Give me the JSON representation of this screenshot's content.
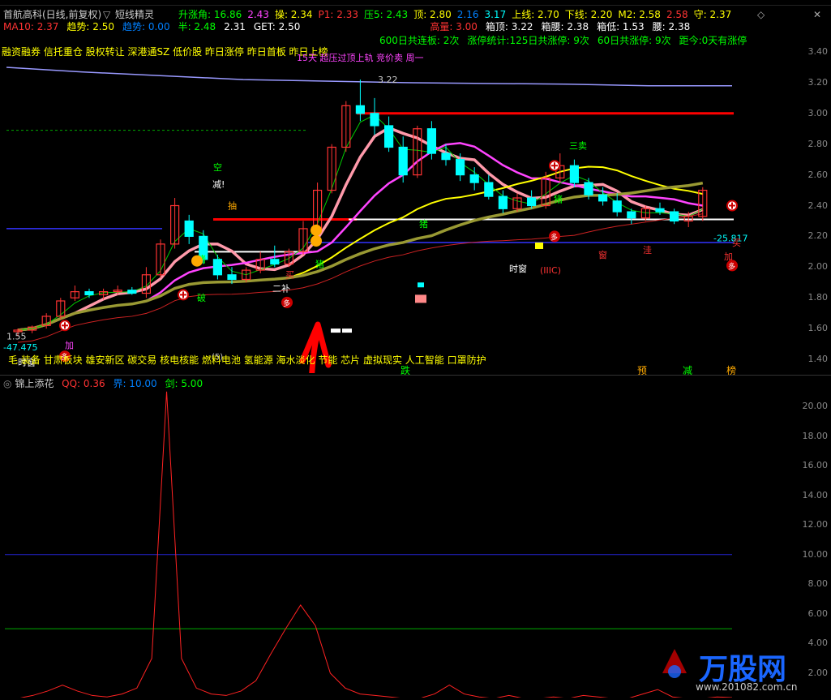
{
  "toolbar": {
    "title": "首航高科(日线,前复权)",
    "chevron": "▽",
    "tool_name": "短线精灵",
    "diamond": "◇",
    "close": "✕"
  },
  "row1": [
    {
      "text": "升涨角: 16.86",
      "color": "#00ff00"
    },
    {
      "text": "2.43",
      "color": "#ff44ff"
    },
    {
      "text": "操: 2.34",
      "color": "#ffff00"
    },
    {
      "text": "P1: 2.33",
      "color": "#ff3333"
    },
    {
      "text": "压5: 2.43",
      "color": "#00ff00"
    },
    {
      "text": "顶: 2.80",
      "color": "#ffff00"
    },
    {
      "text": "2.16",
      "color": "#0080ff"
    },
    {
      "text": "3.17",
      "color": "#00ffff"
    },
    {
      "text": "上线: 2.70",
      "color": "#ffff00"
    },
    {
      "text": "下线: 2.20",
      "color": "#ffff00"
    },
    {
      "text": "M2: 2.58",
      "color": "#ffff00"
    },
    {
      "text": "2.58",
      "color": "#ff3333"
    },
    {
      "text": "守: 2.37",
      "color": "#ffff00"
    }
  ],
  "row2": [
    {
      "text": "MA10: 2.37",
      "color": "#ff3333"
    },
    {
      "text": "趋势: 2.50",
      "color": "#ffff00"
    },
    {
      "text": "趋势: 0.00",
      "color": "#0080ff"
    },
    {
      "text": "半: 2.48",
      "color": "#00ff00"
    },
    {
      "text": "2.31",
      "color": "#ffffff"
    },
    {
      "text": "GET: 2.50",
      "color": "#ffffff"
    },
    {
      "text": "高量: 3.00",
      "color": "#ff3333"
    },
    {
      "text": "箱顶: 3.22",
      "color": "#ffffff"
    },
    {
      "text": "箱腰: 2.38",
      "color": "#ffffff"
    },
    {
      "text": "箱低: 1.53",
      "color": "#ffffff"
    },
    {
      "text": "腰: 2.38",
      "color": "#ffffff"
    }
  ],
  "row3": [
    {
      "text": "600日共连板: 2次",
      "color": "#00ff00"
    },
    {
      "text": "涨停统计:125日共涨停: 9次",
      "color": "#00ff00"
    },
    {
      "text": "60日共涨停: 9次",
      "color": "#00ff00"
    },
    {
      "text": "距今:0天有涨停",
      "color": "#00ff00"
    }
  ],
  "concepts_top": "融资融券 信托重仓 股权转让 深港通SZ 低价股 昨日涨停 昨日首板 昨日上榜",
  "concepts_bottom": "毛 装备 甘肃板块 雄安新区 碳交易 核电核能 燃料电池 氢能源 海水淡化 节能 芯片 虚拟现实 人工智能 口罩防护",
  "notice": "15天 超压过顶上轨 竞价卖 周一",
  "bottom_tags": [
    {
      "text": "跌",
      "color": "#00ff00"
    },
    {
      "text": "预",
      "color": "#ffaa00"
    },
    {
      "text": "减",
      "color": "#00ff00"
    },
    {
      "text": "榜",
      "color": "#ffaa00"
    }
  ],
  "price_axis": [
    "3.40",
    "3.20",
    "3.00",
    "2.80",
    "2.60",
    "2.40",
    "2.20",
    "2.00",
    "1.80",
    "1.60",
    "1.40"
  ],
  "ind_axis": [
    "20.00",
    "18.00",
    "16.00",
    "14.00",
    "12.00",
    "10.00",
    "8.00",
    "6.00",
    "4.00",
    "2.00"
  ],
  "indicator": {
    "name": "锦上添花",
    "qq": "QQ: 0.36",
    "jie": "界: 10.00",
    "jian": "剑: 5.00"
  },
  "annotations": {
    "peak_label": "3.22",
    "low_label": "1.55",
    "val_neg1": "-47.475",
    "val_neg2": "-25.817",
    "time_window": "时窗",
    "time_window2": "时窗",
    "cycle": "(IIIC)",
    "three_sell": "三卖",
    "buy": "买",
    "add": "加",
    "duo": "多",
    "kong": "空",
    "jian": "减!",
    "er_bu": "二补",
    "po": "破",
    "chou": "抽",
    "zhu": "猪",
    "mai": "买",
    "wa": "洼",
    "jiu": "(5)"
  },
  "watermark": {
    "brand": "万股网",
    "url": "www.201082.com.cn"
  },
  "colors": {
    "up": "#ff3333",
    "down": "#00ffff",
    "ma_yellow": "#ffff00",
    "ma_pink": "#ff99aa",
    "ma_magenta": "#ff44ff",
    "ma_olive": "#999933",
    "ma_purple": "#9999ff",
    "ma_green": "#00cc00",
    "red_line": "#ff0000"
  },
  "candles": [
    [
      1.58,
      1.6,
      1.55,
      1.59
    ],
    [
      1.59,
      1.62,
      1.57,
      1.61
    ],
    [
      1.62,
      1.7,
      1.6,
      1.68
    ],
    [
      1.68,
      1.8,
      1.66,
      1.78
    ],
    [
      1.8,
      1.88,
      1.78,
      1.84
    ],
    [
      1.84,
      1.86,
      1.8,
      1.82
    ],
    [
      1.82,
      1.86,
      1.79,
      1.84
    ],
    [
      1.84,
      1.88,
      1.82,
      1.85
    ],
    [
      1.85,
      1.87,
      1.82,
      1.83
    ],
    [
      1.83,
      2.0,
      1.8,
      1.95
    ],
    [
      1.95,
      2.18,
      1.93,
      2.15
    ],
    [
      2.15,
      2.45,
      2.12,
      2.4
    ],
    [
      2.3,
      2.34,
      2.15,
      2.2
    ],
    [
      2.2,
      2.24,
      2.02,
      2.05
    ],
    [
      2.05,
      2.08,
      1.92,
      1.95
    ],
    [
      1.95,
      2.0,
      1.89,
      1.92
    ],
    [
      1.92,
      2.0,
      1.9,
      1.98
    ],
    [
      1.98,
      2.1,
      1.96,
      2.05
    ],
    [
      2.05,
      2.14,
      2.0,
      2.02
    ],
    [
      2.02,
      2.12,
      2.0,
      2.1
    ],
    [
      2.1,
      2.3,
      2.08,
      2.25
    ],
    [
      2.25,
      2.55,
      2.22,
      2.5
    ],
    [
      2.5,
      2.8,
      2.48,
      2.78
    ],
    [
      2.78,
      3.08,
      2.75,
      3.05
    ],
    [
      3.05,
      3.22,
      2.95,
      3.0
    ],
    [
      3.0,
      3.1,
      2.86,
      2.92
    ],
    [
      2.92,
      2.98,
      2.75,
      2.78
    ],
    [
      2.78,
      2.85,
      2.55,
      2.6
    ],
    [
      2.6,
      2.92,
      2.58,
      2.9
    ],
    [
      2.9,
      2.95,
      2.7,
      2.74
    ],
    [
      2.74,
      2.8,
      2.66,
      2.7
    ],
    [
      2.7,
      2.74,
      2.56,
      2.6
    ],
    [
      2.6,
      2.65,
      2.5,
      2.55
    ],
    [
      2.55,
      2.6,
      2.44,
      2.46
    ],
    [
      2.46,
      2.5,
      2.35,
      2.38
    ],
    [
      2.38,
      2.48,
      2.36,
      2.45
    ],
    [
      2.45,
      2.5,
      2.38,
      2.4
    ],
    [
      2.4,
      2.62,
      2.38,
      2.58
    ],
    [
      2.58,
      2.74,
      2.55,
      2.66
    ],
    [
      2.66,
      2.7,
      2.52,
      2.55
    ],
    [
      2.55,
      2.58,
      2.44,
      2.47
    ],
    [
      2.47,
      2.52,
      2.4,
      2.43
    ],
    [
      2.43,
      2.48,
      2.33,
      2.36
    ],
    [
      2.36,
      2.38,
      2.28,
      2.32
    ],
    [
      2.32,
      2.4,
      2.3,
      2.38
    ],
    [
      2.38,
      2.42,
      2.34,
      2.36
    ],
    [
      2.36,
      2.38,
      2.28,
      2.3
    ],
    [
      2.3,
      2.36,
      2.26,
      2.33
    ],
    [
      2.33,
      2.52,
      2.3,
      2.5
    ]
  ],
  "indicator_values": [
    0.3,
    0.5,
    0.8,
    1.2,
    0.8,
    0.5,
    0.4,
    0.6,
    1.0,
    3.0,
    21.0,
    3.0,
    1.0,
    0.6,
    0.5,
    0.8,
    1.5,
    3.3,
    5.0,
    6.6,
    5.2,
    2.0,
    1.0,
    0.6,
    0.5,
    0.4,
    0.3,
    0.3,
    0.6,
    1.2,
    0.6,
    0.4,
    0.3,
    0.5,
    0.3,
    0.3,
    0.4,
    0.3,
    0.5,
    0.4,
    0.3,
    0.3,
    0.6,
    0.9,
    0.4,
    0.3,
    0.3,
    0.4,
    0.36
  ]
}
